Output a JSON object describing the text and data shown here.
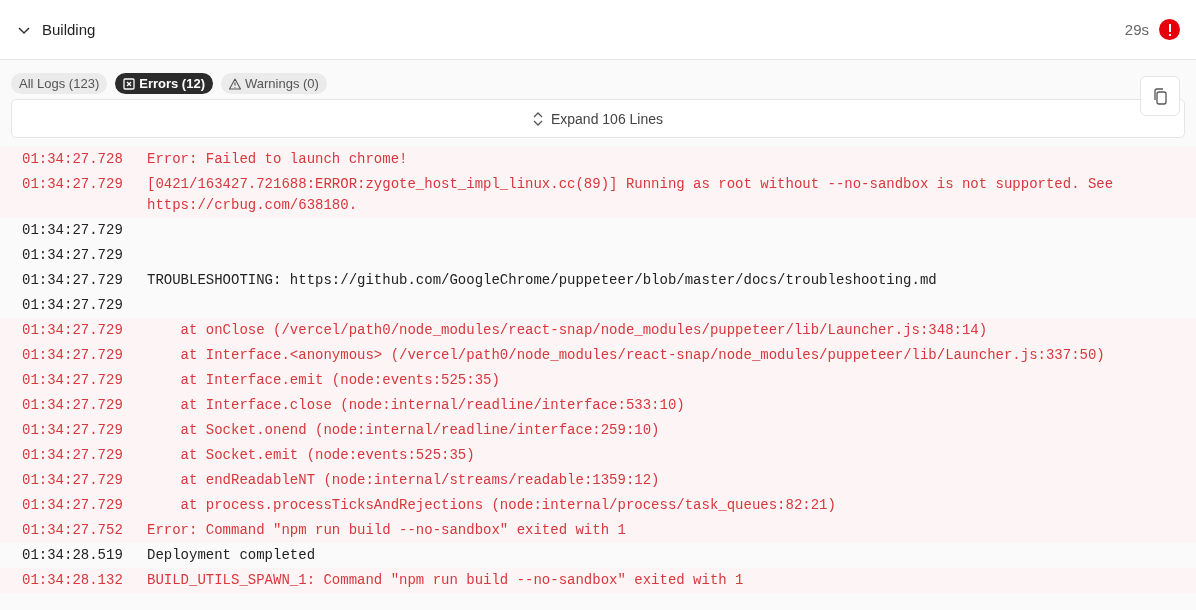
{
  "header": {
    "title": "Building",
    "expanded": true,
    "duration": "29s",
    "failed": true
  },
  "filters": [
    {
      "label": "All Logs (123)",
      "kind": "all",
      "selected": false
    },
    {
      "label": "Errors (12)",
      "kind": "error",
      "selected": true
    },
    {
      "label": "Warnings (0)",
      "kind": "warning",
      "selected": false
    }
  ],
  "expand_button": {
    "label": "Expand 106 Lines"
  },
  "logs": [
    {
      "time": "01:34:27.728",
      "message": "Error: Failed to launch chrome!",
      "error": true
    },
    {
      "time": "01:34:27.729",
      "message": "[0421/163427.721688:ERROR:zygote_host_impl_linux.cc(89)] Running as root without --no-sandbox is not supported. See https://crbug.com/638180.",
      "error": true
    },
    {
      "time": "01:34:27.729",
      "error": false
    },
    {
      "time": "01:34:27.729",
      "error": false
    },
    {
      "time": "01:34:27.729",
      "message": "TROUBLESHOOTING: https://github.com/GoogleChrome/puppeteer/blob/master/docs/troubleshooting.md",
      "error": false
    },
    {
      "time": "01:34:27.729",
      "error": false
    },
    {
      "time": "01:34:27.729",
      "message": "    at onClose (/vercel/path0/node_modules/react-snap/node_modules/puppeteer/lib/Launcher.js:348:14)",
      "error": true
    },
    {
      "time": "01:34:27.729",
      "message": "    at Interface.<anonymous> (/vercel/path0/node_modules/react-snap/node_modules/puppeteer/lib/Launcher.js:337:50)",
      "error": true
    },
    {
      "time": "01:34:27.729",
      "message": "    at Interface.emit (node:events:525:35)",
      "error": true
    },
    {
      "time": "01:34:27.729",
      "message": "    at Interface.close (node:internal/readline/interface:533:10)",
      "error": true
    },
    {
      "time": "01:34:27.729",
      "message": "    at Socket.onend (node:internal/readline/interface:259:10)",
      "error": true
    },
    {
      "time": "01:34:27.729",
      "message": "    at Socket.emit (node:events:525:35)",
      "error": true
    },
    {
      "time": "01:34:27.729",
      "message": "    at endReadableNT (node:internal/streams/readable:1359:12)",
      "error": true
    },
    {
      "time": "01:34:27.729",
      "message": "    at process.processTicksAndRejections (node:internal/process/task_queues:82:21)",
      "error": true
    },
    {
      "time": "01:34:27.752",
      "message": "Error: Command \"npm run build --no-sandbox\" exited with 1",
      "error": true
    },
    {
      "time": "01:34:28.519",
      "message": "Deployment completed",
      "error": false
    },
    {
      "time": "01:34:28.132",
      "message": "BUILD_UTILS_SPAWN_1: Command \"npm run build --no-sandbox\" exited with 1",
      "error": true
    }
  ]
}
